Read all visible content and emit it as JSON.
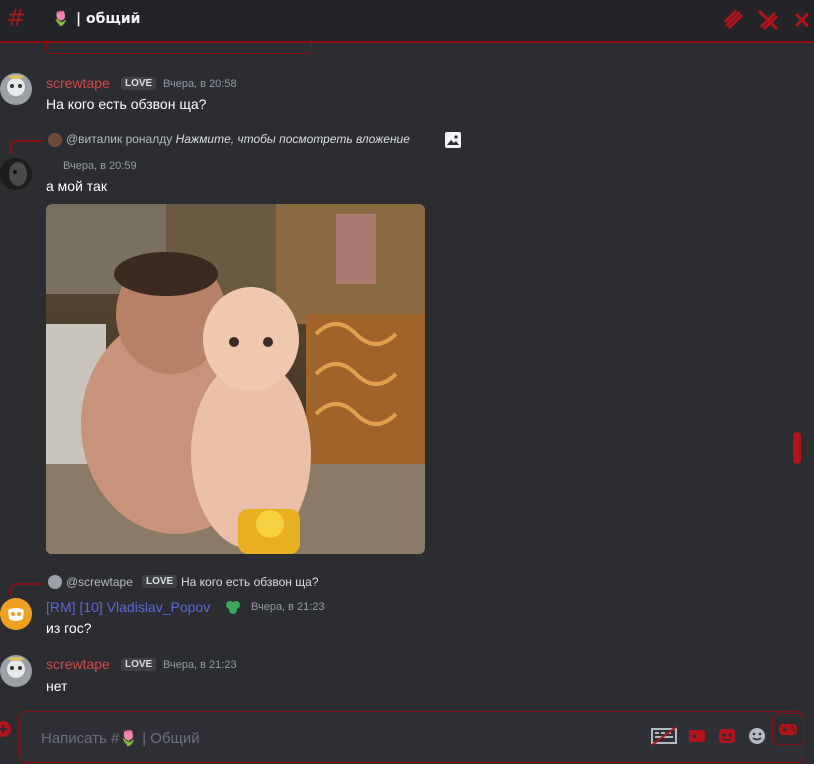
{
  "header": {
    "hash_symbol": "#",
    "channel_emoji": "🌷",
    "channel_name": "| общий"
  },
  "messages": [
    {
      "username": "screwtape",
      "tag": "LOVE",
      "time": "Вчера, в 20:58",
      "text": "На кого есть обзвон ща?"
    },
    {
      "reply_user": "@виталик роналду",
      "reply_text": "Нажмите, чтобы посмотреть вложение",
      "time": "Вчера, в 20:59",
      "text": "а мой так"
    },
    {
      "reply_user": "@screwtape",
      "reply_tag": "LOVE",
      "reply_text": "На кого есть обзвон ща?",
      "username": "[RM] [10] Vladislav_Popov",
      "time": "Вчера, в 21:23",
      "text": "из гос?"
    },
    {
      "username": "screwtape",
      "tag": "LOVE",
      "time": "Вчера, в 21:23",
      "text": "нет"
    }
  ],
  "composer": {
    "placeholder": "Написать #🌷 | Общий"
  },
  "colors": {
    "accent": "#b01418",
    "username_red": "#d04a4a",
    "username_blue": "#5a67d8",
    "background": "#2b2d31"
  }
}
